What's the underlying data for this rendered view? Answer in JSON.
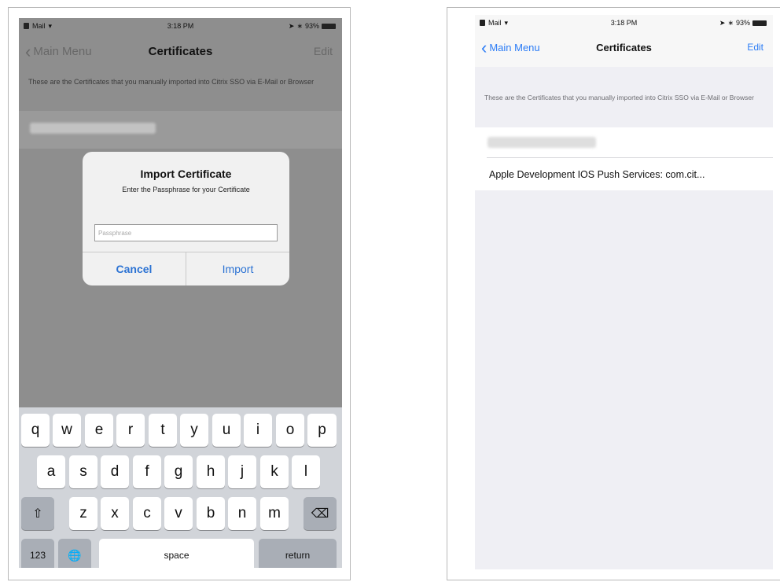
{
  "left_screen": {
    "status": {
      "carrier": "Mail",
      "time": "3:18 PM",
      "battery": "93%"
    },
    "nav": {
      "back_label": "Main Menu",
      "title": "Certificates",
      "edit_label": "Edit"
    },
    "header_note": "These are the Certificates that you manually imported into Citrix SSO via E-Mail or Browser",
    "alert": {
      "title": "Import Certificate",
      "message": "Enter the Passphrase for your Certificate",
      "input_placeholder": "Passphrase",
      "cancel_label": "Cancel",
      "import_label": "Import"
    },
    "keyboard": {
      "row1": [
        "q",
        "w",
        "e",
        "r",
        "t",
        "y",
        "u",
        "i",
        "o",
        "p"
      ],
      "row2": [
        "a",
        "s",
        "d",
        "f",
        "g",
        "h",
        "j",
        "k",
        "l"
      ],
      "row3": [
        "z",
        "x",
        "c",
        "v",
        "b",
        "n",
        "m"
      ],
      "shift_glyph": "⇧",
      "delete_glyph": "⌫",
      "numbers_label": "123",
      "globe_glyph": "🌐",
      "space_label": "space",
      "return_label": "return"
    }
  },
  "right_screen": {
    "status": {
      "carrier": "Mail",
      "time": "3:18 PM",
      "battery": "93%"
    },
    "nav": {
      "back_label": "Main Menu",
      "title": "Certificates",
      "edit_label": "Edit"
    },
    "header_note": "These are the Certificates that you manually imported into Citrix SSO via E-Mail or Browser",
    "certificates": [
      {
        "label": ""
      },
      {
        "label": "Apple Development IOS Push Services: com.cit..."
      }
    ]
  },
  "colors": {
    "ios_blue": "#2b7cf6",
    "dimmed_background": "#8e8e8e",
    "keyboard_background": "#d1d4d9",
    "grouped_background": "#efeff4"
  }
}
